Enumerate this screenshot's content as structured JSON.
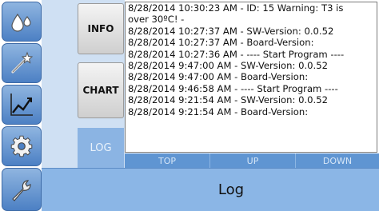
{
  "sidebar": {
    "icons": [
      "water-drops-icon",
      "magic-wand-icon",
      "chart-line-icon",
      "gear-icon",
      "wrench-icon"
    ]
  },
  "tabs": [
    {
      "label": "INFO"
    },
    {
      "label": "CHART"
    },
    {
      "label": "LOG"
    }
  ],
  "log": {
    "lines": [
      "8/28/2014 10:30:23 AM - ID: 15 Warning: T3 is",
      "over 30ºC!  -",
      "8/28/2014 10:27:37 AM - SW-Version: 0.0.52",
      "8/28/2014 10:27:37 AM - Board-Version:",
      "8/28/2014 10:27:36 AM - ---- Start Program ----",
      "8/28/2014 9:47:00 AM - SW-Version: 0.0.52",
      "8/28/2014 9:47:00 AM - Board-Version:",
      "8/28/2014 9:46:58 AM - ---- Start Program ----",
      "8/28/2014 9:21:54 AM - SW-Version: 0.0.52",
      "8/28/2014 9:21:54 AM - Board-Version:"
    ]
  },
  "buttons": {
    "top": "TOP",
    "up": "UP",
    "down": "DOWN"
  },
  "title": "Log"
}
